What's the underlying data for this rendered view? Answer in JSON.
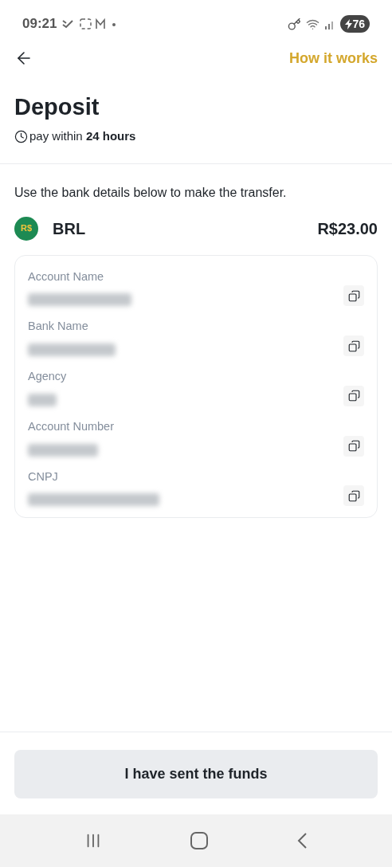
{
  "status_bar": {
    "time": "09:21",
    "battery": "76"
  },
  "header": {
    "link": "How it works"
  },
  "title": "Deposit",
  "deadline": "pay within **24 hours**",
  "instruction": "Use the bank details below to make the transfer.",
  "currency": {
    "code": "BRL",
    "symbol": "R$",
    "amount": "R$23.00"
  },
  "fields": [
    {
      "label": "Account Name",
      "redacted": true
    },
    {
      "label": "Bank Name",
      "redacted": true
    },
    {
      "label": "Agency",
      "redacted": true
    },
    {
      "label": "Account Number",
      "redacted": true
    },
    {
      "label": "CNPJ",
      "redacted": true
    }
  ],
  "button": "I have sent the funds"
}
